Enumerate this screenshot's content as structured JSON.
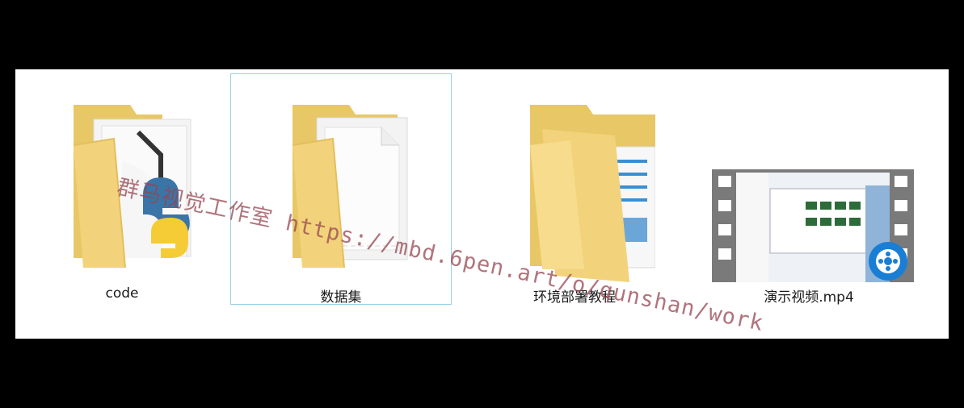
{
  "background_color": "#000000",
  "panel_color": "#ffffff",
  "selection_border_color": "#99d1e7",
  "items": [
    {
      "name": "code",
      "icon": "folder-python-icon"
    },
    {
      "name": "数据集",
      "icon": "folder-document-icon",
      "selected": true
    },
    {
      "name": "环境部署教程",
      "icon": "folder-open-document-icon"
    },
    {
      "name": "演示视频.mp4",
      "icon": "video-file-icon"
    }
  ],
  "watermark": "群马视觉工作室 https://mbd.6pen.art/o/qunshan/work"
}
